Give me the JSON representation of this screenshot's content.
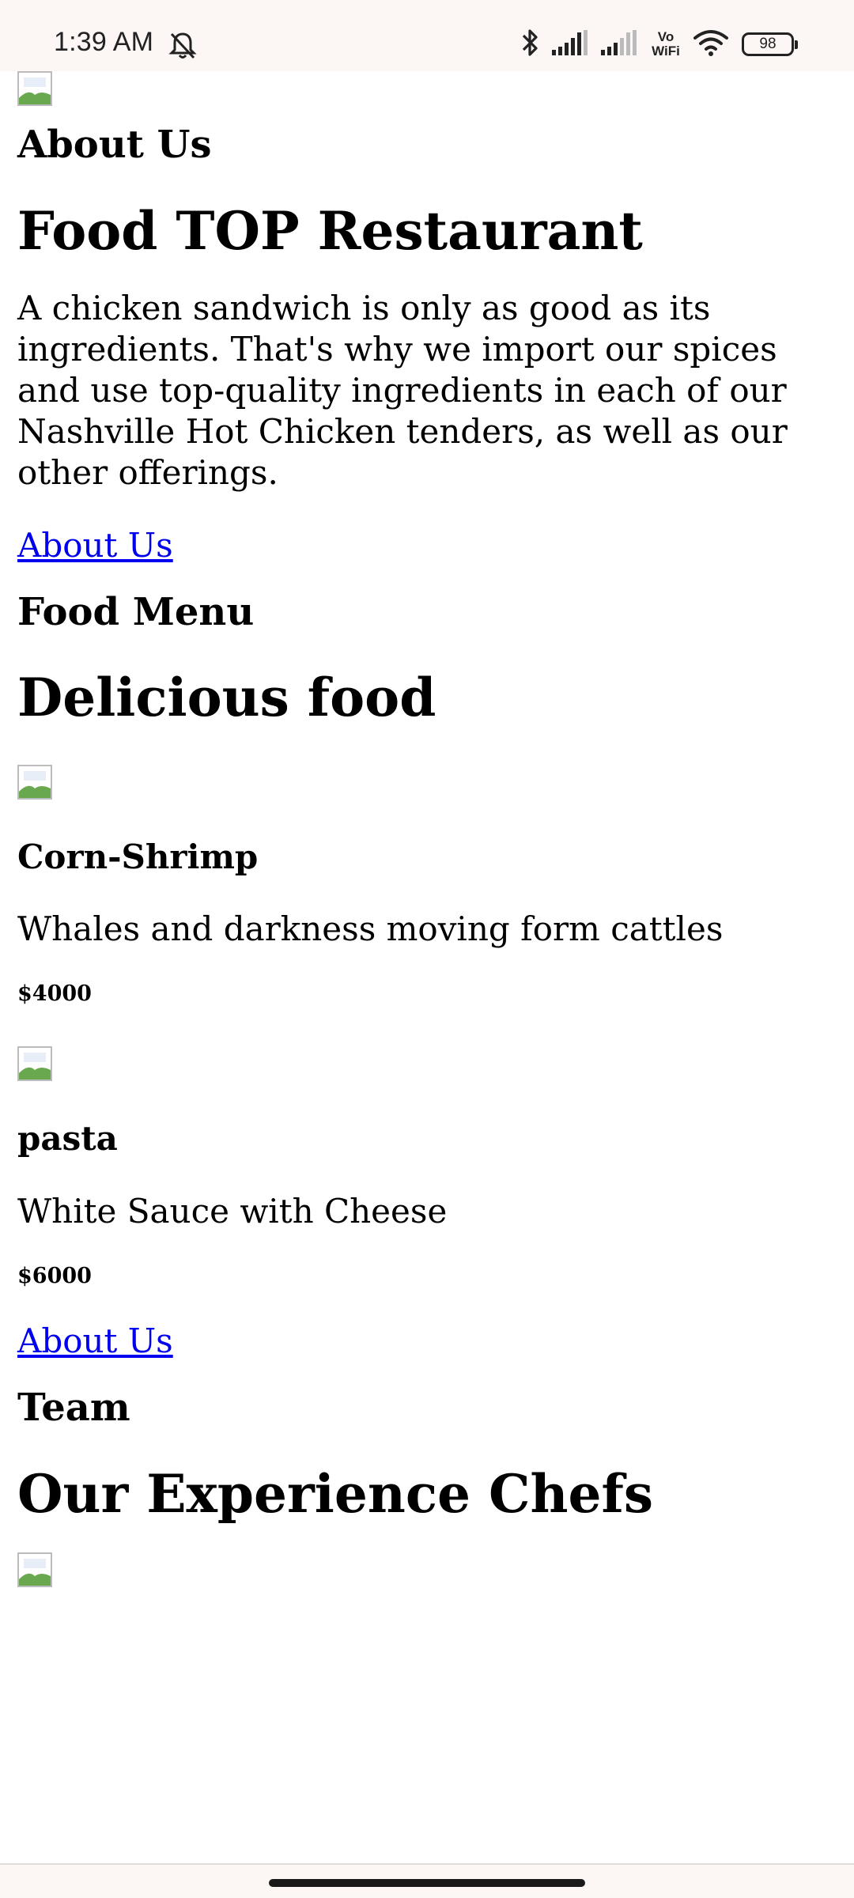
{
  "status_bar": {
    "time": "1:39 AM",
    "vowifi_top": "Vo",
    "vowifi_bottom": "WiFi",
    "battery": "98"
  },
  "about": {
    "eyebrow": "About Us",
    "title": "Food TOP Restaurant",
    "text": "A chicken sandwich is only as good as its ingredients. That's why we import our spices and use top-quality ingredients in each of our Nashville Hot Chicken tenders, as well as our other offerings.",
    "link": "About Us"
  },
  "menu": {
    "eyebrow": "Food Menu",
    "title": "Delicious food",
    "items": [
      {
        "name": "Corn-Shrimp",
        "desc": "Whales and darkness moving form cattles",
        "price": "$4000"
      },
      {
        "name": "pasta",
        "desc": "White Sauce with Cheese",
        "price": "$6000"
      }
    ],
    "link": "About Us"
  },
  "team": {
    "eyebrow": "Team",
    "title": "Our Experience Chefs"
  }
}
